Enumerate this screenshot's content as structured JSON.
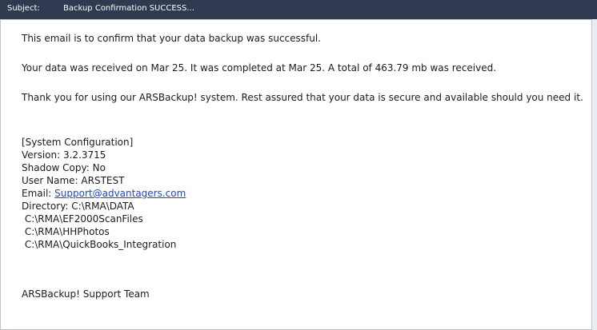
{
  "header": {
    "subject_label": "Subject:",
    "subject_value": "Backup Confirmation SUCCESS..."
  },
  "message": {
    "line_confirm": "This email is to confirm that your data backup was successful.",
    "line_received": "Your data was received on Mar 25. It was completed at Mar 25. A total of 463.79 mb was received.",
    "line_thanks": "Thank you for using our ARSBackup! system. Rest assured that your data is secure and available should you need it.",
    "config": {
      "heading": "[System Configuration]",
      "version": "Version: 3.2.3715",
      "shadow_copy": "Shadow Copy: No",
      "user_name": "User Name: ARSTEST",
      "email_label": "Email: ",
      "email_link": "Support@advantagers.com",
      "directory": "Directory: C:\\RMA\\DATA",
      "dir2": " C:\\RMA\\EF2000ScanFiles",
      "dir3": " C:\\RMA\\HHPhotos",
      "dir4": " C:\\RMA\\QuickBooks_Integration"
    },
    "signature": "ARSBackup! Support Team"
  }
}
